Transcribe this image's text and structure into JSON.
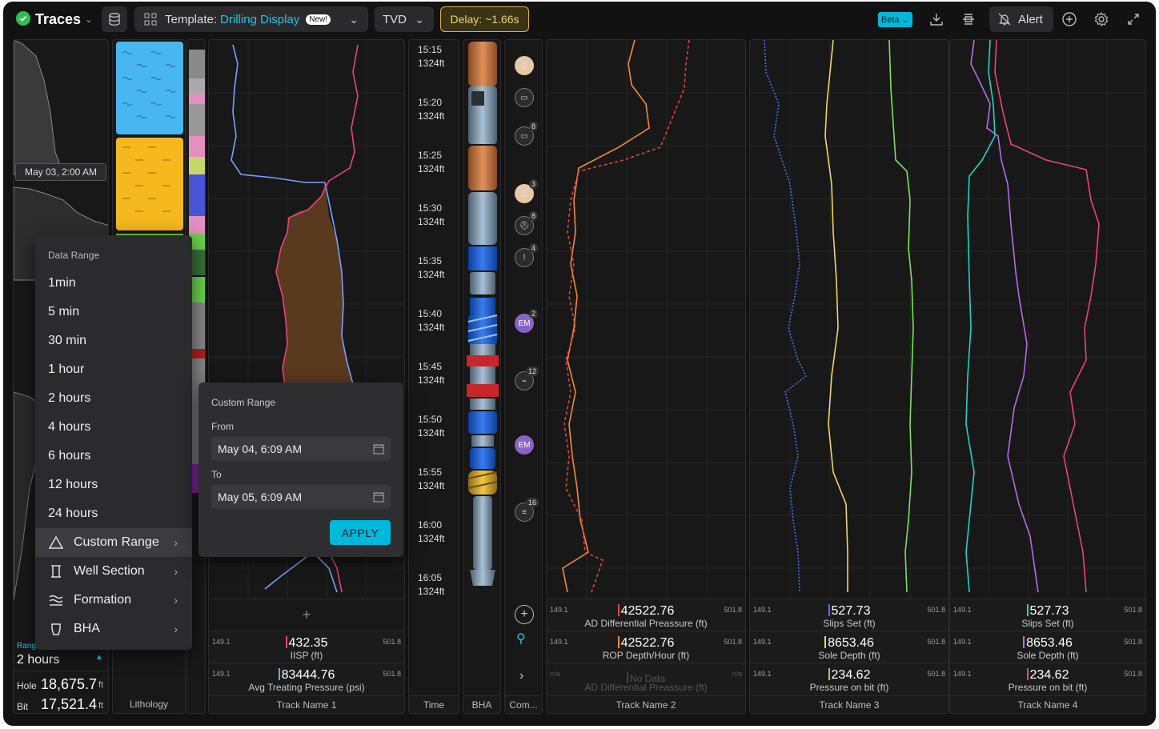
{
  "app": {
    "title": "Traces",
    "template_prefix": "Template:",
    "template_name": "Drilling Display",
    "new_badge": "New!",
    "depth_mode": "TVD",
    "delay": "Delay: ~1.66s",
    "beta": "Beta",
    "alert": "Alert"
  },
  "colors": {
    "accent": "#00b8d9",
    "delay_border": "#e3b341",
    "status_ok": "#2fbf4f"
  },
  "left_panel": {
    "date_tag": "May 03, 2:00 AM",
    "range_label": "Range",
    "range_value": "2 hours",
    "hole_label": "Hole",
    "hole_value": "18,675.7",
    "bit_label": "Bit",
    "bit_value": "17,521.4",
    "unit": "ft",
    "lithology": "Lithology"
  },
  "menu": {
    "header": "Data Range",
    "items": [
      "1min",
      "5 min",
      "30 min",
      "1 hour",
      "2 hours",
      "4 hours",
      "6 hours",
      "12 hours",
      "24 hours"
    ],
    "sub": [
      {
        "label": "Custom Range",
        "icon": "triangle-icon"
      },
      {
        "label": "Well Section",
        "icon": "well-section-icon"
      },
      {
        "label": "Formation",
        "icon": "formation-icon"
      },
      {
        "label": "BHA",
        "icon": "bha-icon"
      }
    ]
  },
  "custom_range": {
    "title": "Custom Range",
    "from_label": "From",
    "from_value": "May 04, 6:09 AM",
    "to_label": "To",
    "to_value": "May 05, 6:09 AM",
    "apply": "APPLY"
  },
  "time_track": {
    "name": "Time",
    "times": [
      "15:15",
      "15:20",
      "15:25",
      "15:30",
      "15:35",
      "15:40",
      "15:45",
      "15:50",
      "15:55",
      "16:00",
      "16:05"
    ],
    "depth": "1324ft"
  },
  "bha_track": {
    "name": "BHA"
  },
  "comments_track": {
    "name": "Com...",
    "badges": [
      "8",
      "3",
      "8",
      "4",
      "2",
      "12",
      "16"
    ],
    "initials": "EM"
  },
  "tracks": [
    {
      "name": "Track Name 1",
      "readouts": [
        {
          "min": "149.1",
          "max": "501.8",
          "value": "432.35",
          "label": "IISP (ft)",
          "color": "#e8457a"
        },
        {
          "min": "149.1",
          "max": "501.8",
          "value": "83444.76",
          "label": "Avg Treating Pressure (psi)",
          "color": "#7aa0ff"
        }
      ]
    },
    {
      "name": "Track Name 2",
      "readouts": [
        {
          "min": "149.1",
          "max": "501.8",
          "value": "42522.76",
          "label": "AD Differential Preassure (ft)",
          "color": "#e0443a"
        },
        {
          "min": "149.1",
          "max": "501.8",
          "value": "42522.76",
          "label": "ROP Depth/Hour (ft)",
          "color": "#f08a3a"
        },
        {
          "min": "n/a",
          "max": "n/a",
          "value": "No Data",
          "label": "AD Differential Preassure (ft)",
          "color": "#444"
        }
      ]
    },
    {
      "name": "Track Name 3",
      "readouts": [
        {
          "min": "149.1",
          "max": "501.8",
          "value": "527.73",
          "label": "Slips Set (ft)",
          "color": "#4f6dff"
        },
        {
          "min": "149.1",
          "max": "501.8",
          "value": "8653.46",
          "label": "Sole Depth (ft)",
          "color": "#f3d36b"
        },
        {
          "min": "149.1",
          "max": "501.8",
          "value": "234.62",
          "label": "Pressure on bit (ft)",
          "color": "#7ee05b"
        }
      ]
    },
    {
      "name": "Track Name 4",
      "readouts": [
        {
          "min": "149.1",
          "max": "501.8",
          "value": "527.73",
          "label": "Slips Set (ft)",
          "color": "#22d3c5"
        },
        {
          "min": "149.1",
          "max": "501.8",
          "value": "8653.46",
          "label": "Sole Depth (ft)",
          "color": "#b76ce0"
        },
        {
          "min": "149.1",
          "max": "501.8",
          "value": "234.62",
          "label": "Pressure on bit (ft)",
          "color": "#e8457a"
        }
      ]
    }
  ]
}
